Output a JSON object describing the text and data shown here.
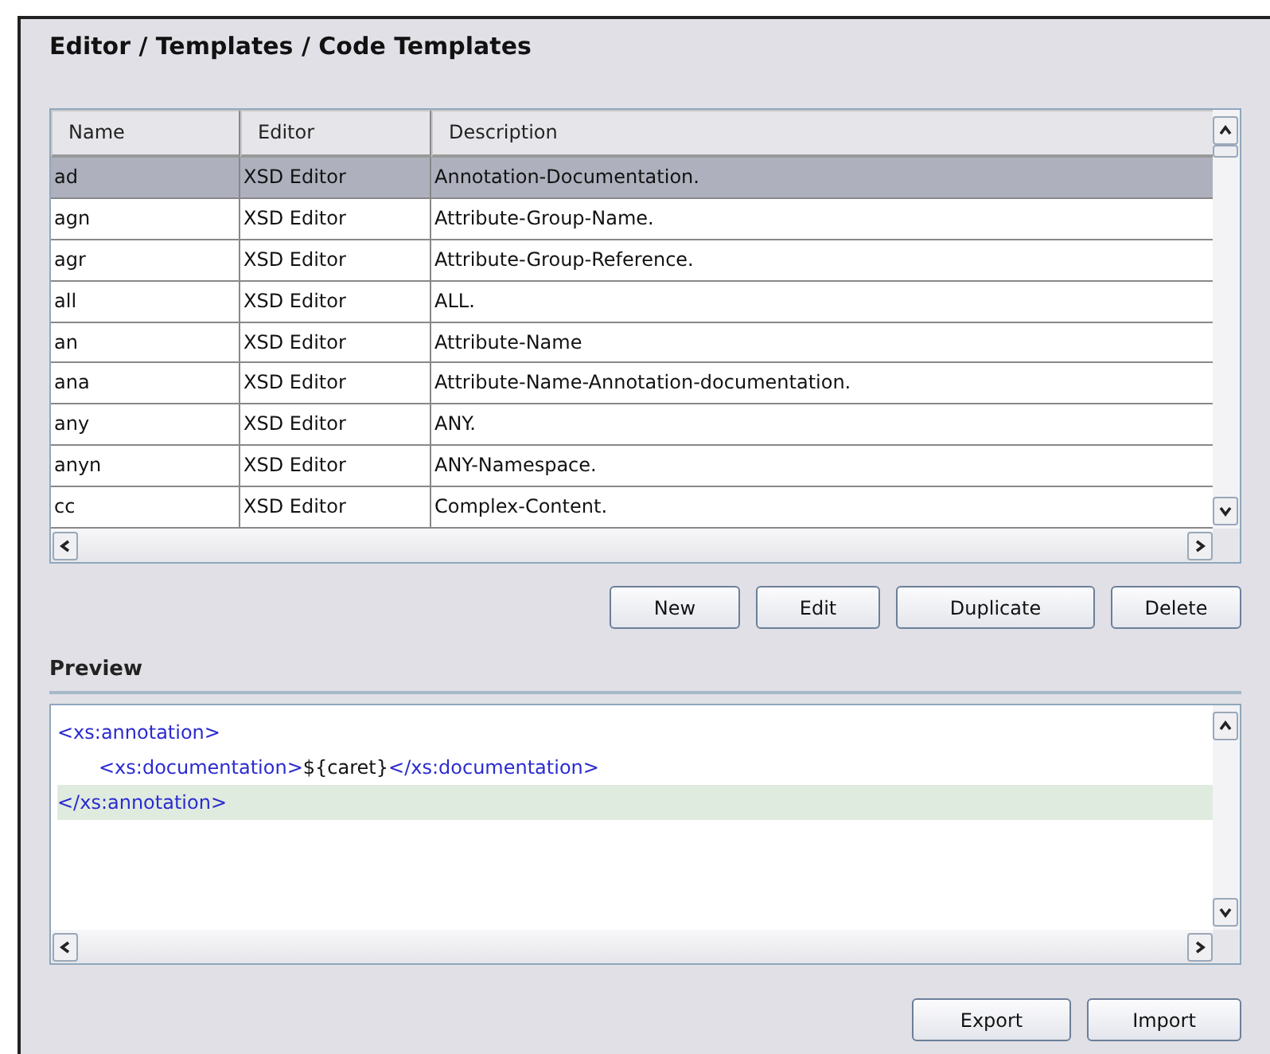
{
  "title": "Editor / Templates / Code Templates",
  "table": {
    "columns": [
      "Name",
      "Editor",
      "Description"
    ],
    "rows": [
      {
        "cells": [
          "ad",
          "XSD Editor",
          "Annotation-Documentation."
        ],
        "selected": true
      },
      {
        "cells": [
          "agn",
          "XSD Editor",
          "Attribute-Group-Name."
        ],
        "selected": false
      },
      {
        "cells": [
          "agr",
          "XSD Editor",
          "Attribute-Group-Reference."
        ],
        "selected": false
      },
      {
        "cells": [
          "all",
          "XSD Editor",
          "ALL."
        ],
        "selected": false
      },
      {
        "cells": [
          "an",
          "XSD Editor",
          "Attribute-Name"
        ],
        "selected": false
      },
      {
        "cells": [
          "ana",
          "XSD Editor",
          "Attribute-Name-Annotation-documentation."
        ],
        "selected": false
      },
      {
        "cells": [
          "any",
          "XSD Editor",
          "ANY."
        ],
        "selected": false
      },
      {
        "cells": [
          "anyn",
          "XSD Editor",
          "ANY-Namespace."
        ],
        "selected": false
      },
      {
        "cells": [
          "cc",
          "XSD Editor",
          "Complex-Content."
        ],
        "selected": false
      }
    ]
  },
  "table_buttons": [
    "New",
    "Edit",
    "Duplicate",
    "Delete"
  ],
  "preview": {
    "label": "Preview",
    "lines": [
      {
        "highlighted": false,
        "segments": [
          {
            "kind": "tag",
            "text": "<xs:annotation>"
          }
        ],
        "children": [
          {
            "highlighted": false,
            "segments": [
              {
                "kind": "tag",
                "text": "<xs:documentation>"
              },
              {
                "kind": "text",
                "text": "${caret}"
              },
              {
                "kind": "tag",
                "text": "</xs:documentation>"
              }
            ]
          }
        ]
      },
      {
        "highlighted": true,
        "segments": [
          {
            "kind": "tag",
            "text": "</xs:annotation>"
          }
        ]
      }
    ]
  },
  "bottom_buttons": [
    "Export",
    "Import"
  ]
}
